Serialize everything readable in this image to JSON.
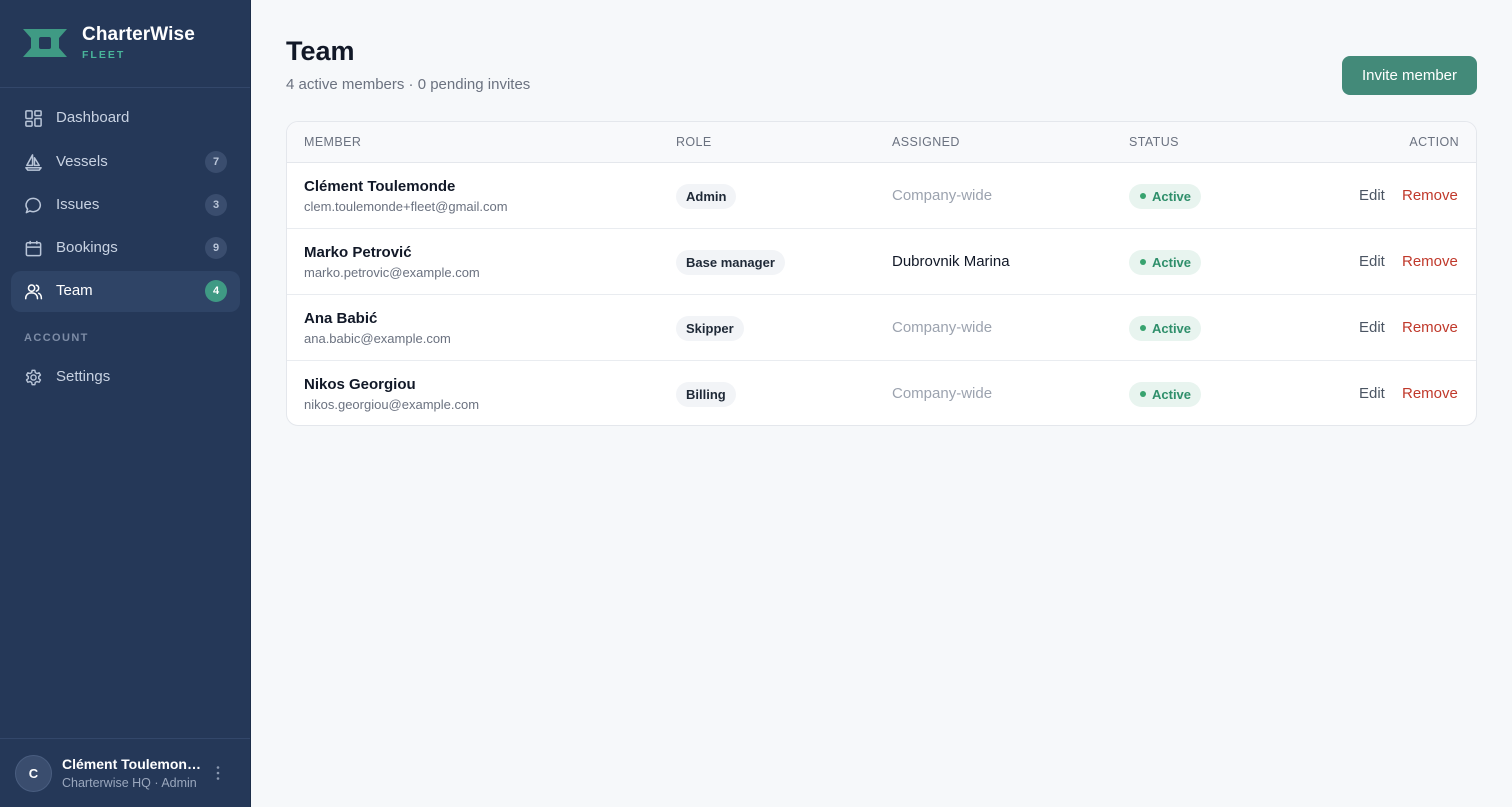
{
  "brand": {
    "name": "CharterWise",
    "sub": "FLEET"
  },
  "sidebar": {
    "items": [
      {
        "label": "Dashboard",
        "badge": null,
        "icon": "dashboard-icon"
      },
      {
        "label": "Vessels",
        "badge": "7",
        "icon": "sailboat-icon"
      },
      {
        "label": "Issues",
        "badge": "3",
        "icon": "chat-icon"
      },
      {
        "label": "Bookings",
        "badge": "9",
        "icon": "calendar-icon"
      },
      {
        "label": "Team",
        "badge": "4",
        "icon": "users-icon",
        "active": true
      }
    ],
    "account_label": "ACCOUNT",
    "settings_label": "Settings"
  },
  "user": {
    "initial": "C",
    "name": "Clément Toulemonde",
    "meta": "Charterwise HQ · Admin"
  },
  "main": {
    "title": "Team",
    "subtitle": "4 active members · 0 pending invites",
    "invite_label": "Invite member"
  },
  "table": {
    "headers": [
      "MEMBER",
      "ROLE",
      "ASSIGNED",
      "STATUS",
      "ACTION"
    ],
    "rows": [
      {
        "name": "Clément Toulemonde",
        "email": "clem.toulemonde+fleet@gmail.com",
        "role": "Admin",
        "assigned": "Company-wide",
        "status": "Active",
        "edit": "Edit",
        "remove": "Remove"
      },
      {
        "name": "Marko Petrović",
        "email": "marko.petrovic@example.com",
        "role": "Base manager",
        "assigned": "Dubrovnik Marina",
        "status": "Active",
        "edit": "Edit",
        "remove": "Remove"
      },
      {
        "name": "Ana Babić",
        "email": "ana.babic@example.com",
        "role": "Skipper",
        "assigned": "Company-wide",
        "status": "Active",
        "edit": "Edit",
        "remove": "Remove"
      },
      {
        "name": "Nikos Georgiou",
        "email": "nikos.georgiou@example.com",
        "role": "Billing",
        "assigned": "Company-wide",
        "status": "Active",
        "edit": "Edit",
        "remove": "Remove"
      }
    ]
  },
  "colors": {
    "sidebar": "#253858",
    "accent": "#438a79",
    "status_active": "#2f8f6b",
    "danger": "#c0392b"
  }
}
